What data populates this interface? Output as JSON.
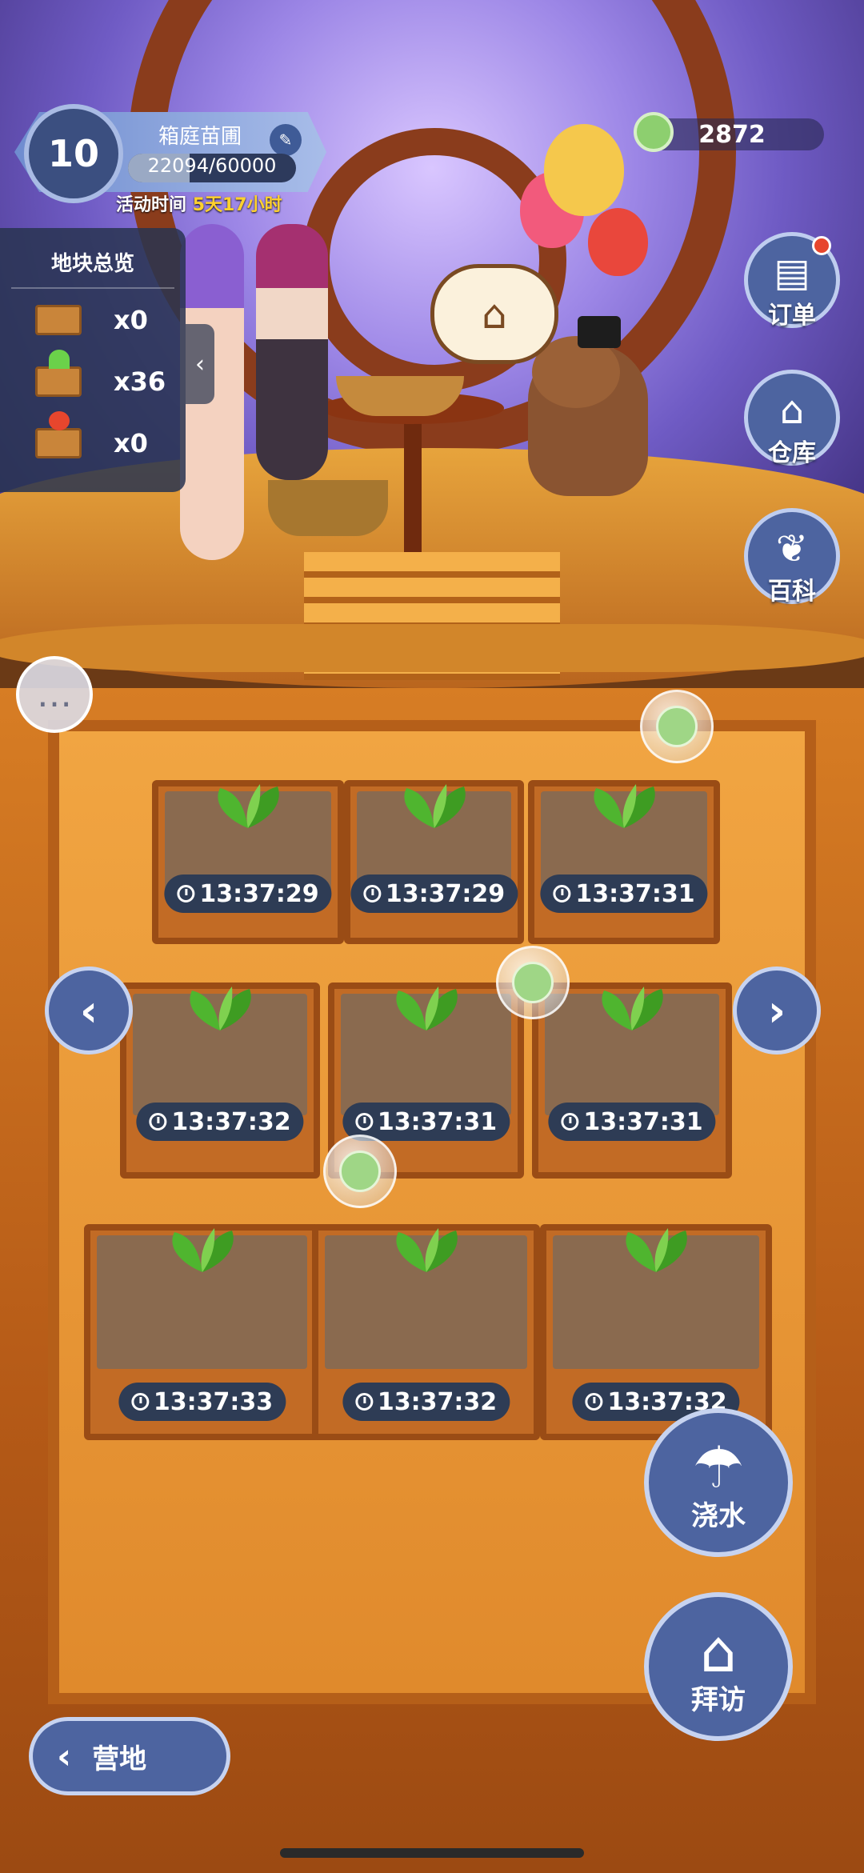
{
  "hud": {
    "level": "10",
    "garden_name": "箱庭苗圃",
    "xp_text": "22094/60000",
    "xp_progress": 0.368,
    "event_label": "活动时间",
    "event_value": "5天17小时",
    "coins": "2872"
  },
  "side_buttons": [
    {
      "label": "订单",
      "icon": "order-icon",
      "has_notification": true
    },
    {
      "label": "仓库",
      "icon": "warehouse-icon",
      "has_notification": false
    },
    {
      "label": "百科",
      "icon": "encyclopedia-icon",
      "has_notification": false
    }
  ],
  "overview": {
    "title": "地块总览",
    "rows": [
      {
        "icon": "empty-crate-icon",
        "count": "x0"
      },
      {
        "icon": "sprout-crate-icon",
        "count": "x36"
      },
      {
        "icon": "fruit-crate-icon",
        "count": "x0"
      }
    ]
  },
  "planters": [
    {
      "timer": "13:37:29"
    },
    {
      "timer": "13:37:29"
    },
    {
      "timer": "13:37:31"
    },
    {
      "timer": "13:37:32"
    },
    {
      "timer": "13:37:31"
    },
    {
      "timer": "13:37:31"
    },
    {
      "timer": "13:37:33"
    },
    {
      "timer": "13:37:32"
    },
    {
      "timer": "13:37:32"
    }
  ],
  "actions": {
    "water": "浇水",
    "visit": "拜访",
    "camp": "营地"
  },
  "colors": {
    "ui_blue": "#4d64a0",
    "timer_bg": "#2e3c55",
    "event_highlight": "#ffd12e",
    "notification": "#e7462d"
  }
}
